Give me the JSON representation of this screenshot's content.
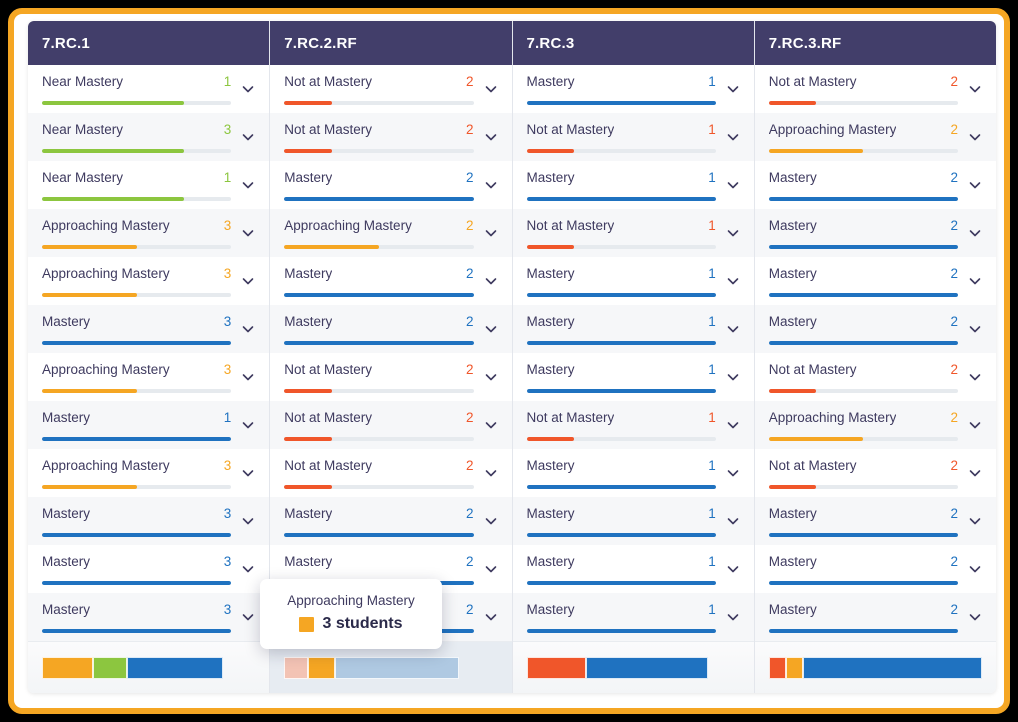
{
  "status_colors": {
    "Mastery": "#1F72C0",
    "Near Mastery": "#8CC63F",
    "Approaching Mastery": "#F5A623",
    "Not at Mastery": "#F0562A"
  },
  "status_fill_percent": {
    "Mastery": 100,
    "Near Mastery": 75,
    "Approaching Mastery": 50,
    "Not at Mastery": 25
  },
  "theme": {
    "header_bg": "#423E6A",
    "frame_border": "#F5A623",
    "track_bg": "#E6EAEE",
    "row_alt_bg": "#F6F7F9",
    "text": "#3E3A5F"
  },
  "chevron_icon": "chevron-down-icon",
  "tooltip": {
    "visible": true,
    "title": "Approaching Mastery",
    "value": "3 students",
    "swatch_color": "#F5A623"
  },
  "columns": [
    {
      "header": "7.RC.1",
      "hovered": false,
      "rows": [
        {
          "label": "Near Mastery",
          "count": "1"
        },
        {
          "label": "Near Mastery",
          "count": "3"
        },
        {
          "label": "Near Mastery",
          "count": "1"
        },
        {
          "label": "Approaching Mastery",
          "count": "3"
        },
        {
          "label": "Approaching Mastery",
          "count": "3"
        },
        {
          "label": "Mastery",
          "count": "3"
        },
        {
          "label": "Approaching Mastery",
          "count": "3"
        },
        {
          "label": "Mastery",
          "count": "1"
        },
        {
          "label": "Approaching Mastery",
          "count": "3"
        },
        {
          "label": "Mastery",
          "count": "3"
        },
        {
          "label": "Mastery",
          "count": "3"
        },
        {
          "label": "Mastery",
          "count": "3"
        }
      ],
      "summary": [
        {
          "label": "Approaching Mastery",
          "color": "#F5A623",
          "percent": 24
        },
        {
          "label": "Near Mastery",
          "color": "#8CC63F",
          "percent": 16
        },
        {
          "label": "Mastery",
          "color": "#1F72C0",
          "percent": 45
        },
        {
          "label": "Empty",
          "color": "transparent",
          "percent": 15
        }
      ]
    },
    {
      "header": "7.RC.2.RF",
      "hovered": true,
      "rows": [
        {
          "label": "Not at Mastery",
          "count": "2"
        },
        {
          "label": "Not at Mastery",
          "count": "2"
        },
        {
          "label": "Mastery",
          "count": "2"
        },
        {
          "label": "Approaching Mastery",
          "count": "2"
        },
        {
          "label": "Mastery",
          "count": "2"
        },
        {
          "label": "Mastery",
          "count": "2"
        },
        {
          "label": "Not at Mastery",
          "count": "2"
        },
        {
          "label": "Not at Mastery",
          "count": "2"
        },
        {
          "label": "Not at Mastery",
          "count": "2"
        },
        {
          "label": "Mastery",
          "count": "2"
        },
        {
          "label": "Mastery",
          "count": "2"
        },
        {
          "label": "Mastery",
          "count": "2"
        }
      ],
      "summary": [
        {
          "label": "Not at Mastery",
          "color": "#F3C3B4",
          "percent": 11
        },
        {
          "label": "Approaching Mastery",
          "color": "#F5A623",
          "percent": 13
        },
        {
          "label": "Mastery",
          "color": "#AFC9E2",
          "percent": 58
        },
        {
          "label": "Empty",
          "color": "transparent",
          "percent": 18
        }
      ]
    },
    {
      "header": "7.RC.3",
      "hovered": false,
      "rows": [
        {
          "label": "Mastery",
          "count": "1"
        },
        {
          "label": "Not at Mastery",
          "count": "1"
        },
        {
          "label": "Mastery",
          "count": "1"
        },
        {
          "label": "Not at Mastery",
          "count": "1"
        },
        {
          "label": "Mastery",
          "count": "1"
        },
        {
          "label": "Mastery",
          "count": "1"
        },
        {
          "label": "Mastery",
          "count": "1"
        },
        {
          "label": "Not at Mastery",
          "count": "1"
        },
        {
          "label": "Mastery",
          "count": "1"
        },
        {
          "label": "Mastery",
          "count": "1"
        },
        {
          "label": "Mastery",
          "count": "1"
        },
        {
          "label": "Mastery",
          "count": "1"
        }
      ],
      "summary": [
        {
          "label": "Not at Mastery",
          "color": "#F0562A",
          "percent": 28
        },
        {
          "label": "Mastery",
          "color": "#1F72C0",
          "percent": 57
        },
        {
          "label": "Empty",
          "color": "transparent",
          "percent": 15
        }
      ]
    },
    {
      "header": "7.RC.3.RF",
      "hovered": false,
      "rows": [
        {
          "label": "Not at Mastery",
          "count": "2"
        },
        {
          "label": "Approaching Mastery",
          "count": "2"
        },
        {
          "label": "Mastery",
          "count": "2"
        },
        {
          "label": "Mastery",
          "count": "2"
        },
        {
          "label": "Mastery",
          "count": "2"
        },
        {
          "label": "Mastery",
          "count": "2"
        },
        {
          "label": "Not at Mastery",
          "count": "2"
        },
        {
          "label": "Approaching Mastery",
          "count": "2"
        },
        {
          "label": "Not at Mastery",
          "count": "2"
        },
        {
          "label": "Mastery",
          "count": "2"
        },
        {
          "label": "Mastery",
          "count": "2"
        },
        {
          "label": "Mastery",
          "count": "2"
        }
      ],
      "summary": [
        {
          "label": "Not at Mastery",
          "color": "#F0562A",
          "percent": 8
        },
        {
          "label": "Approaching Mastery",
          "color": "#F5A623",
          "percent": 8
        },
        {
          "label": "Mastery",
          "color": "#1F72C0",
          "percent": 84
        }
      ]
    }
  ]
}
